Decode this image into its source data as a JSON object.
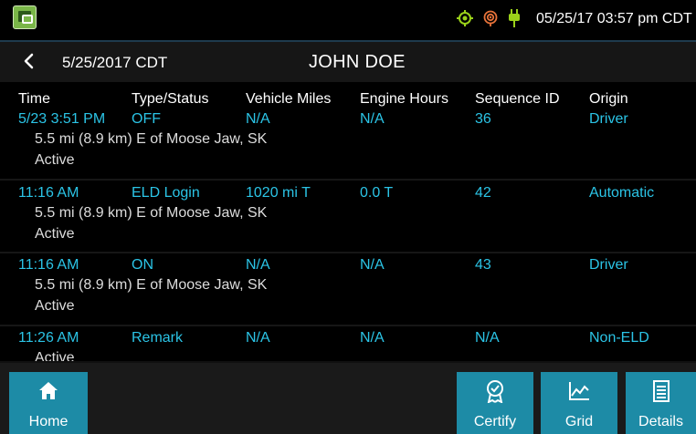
{
  "statusbar": {
    "datetime": "05/25/17 03:57 pm CDT",
    "icons": [
      "gps-icon",
      "location-signal-icon",
      "power-plug-icon"
    ],
    "icon_color": "#9bd21a"
  },
  "titlebar": {
    "date": "5/25/2017 CDT",
    "driver": "JOHN DOE"
  },
  "table": {
    "headers": [
      "Time",
      "Type/Status",
      "Vehicle Miles",
      "Engine Hours",
      "Sequence ID",
      "Origin"
    ],
    "rows": [
      {
        "time": "5/23 3:51 PM",
        "type": "OFF",
        "miles": "N/A",
        "hours": "N/A",
        "seq": "36",
        "origin": "Driver",
        "location": "5.5 mi (8.9 km) E of Moose Jaw, SK",
        "status": "Active"
      },
      {
        "time": "11:16 AM",
        "type": "ELD Login",
        "miles": "1020 mi T",
        "hours": "0.0 T",
        "seq": "42",
        "origin": "Automatic",
        "location": "5.5 mi (8.9 km) E of Moose Jaw, SK",
        "status": "Active"
      },
      {
        "time": "11:16 AM",
        "type": "ON",
        "miles": "N/A",
        "hours": "N/A",
        "seq": "43",
        "origin": "Driver",
        "location": "5.5 mi (8.9 km) E of Moose Jaw, SK",
        "status": "Active"
      },
      {
        "time": "11:26 AM",
        "type": "Remark",
        "miles": "N/A",
        "hours": "N/A",
        "seq": "N/A",
        "origin": "Non-ELD",
        "location": "",
        "status": "Active"
      }
    ],
    "value_color": "#2bc4e6"
  },
  "bottombar": {
    "home": "Home",
    "certify": "Certify",
    "grid": "Grid",
    "details": "Details",
    "button_color": "#1d8ba6"
  }
}
